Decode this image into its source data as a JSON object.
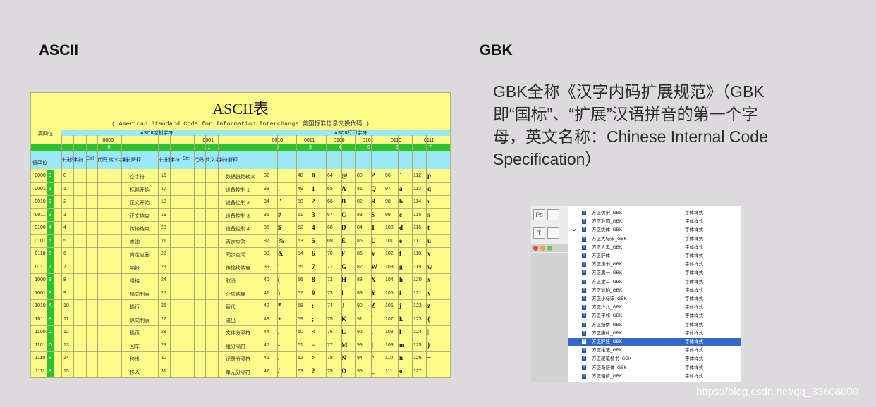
{
  "headings": {
    "ascii": "ASCII",
    "gbk": "GBK"
  },
  "gbk_description": "GBK全称《汉字内码扩展规范》（GBK即“国标”、“扩展”汉语拼音的第一个字母，英文名称：Chinese Internal Code Specification）",
  "ascii_table": {
    "title": "ASCII表",
    "subtitle": "( American Standard Code for Information Interchange  美国标准信息交换代码 )",
    "high_bits_label": "高四位",
    "low_bits_label": "低四位",
    "control_chars_label": "ASCII控制字符",
    "printable_chars_label": "ASCII打印字符",
    "high_groups": [
      "0000",
      "0001",
      "0010",
      "0011",
      "0100",
      "0101",
      "0110",
      "0111"
    ],
    "group_numbers": [
      "0",
      "1",
      "2",
      "3",
      "4",
      "5",
      "6",
      "7"
    ],
    "sub_headers": [
      "十进制",
      "字符",
      "Ctrl",
      "代码",
      "转义字符",
      "字符解释"
    ],
    "rows": [
      {
        "bits": "0000",
        "hex": "0",
        "c0": "0",
        "c0e": "空字符",
        "c1": "16",
        "c1e": "数据链路转义",
        "g2": " ",
        "n2": "32",
        "g3": "0",
        "n3": "48",
        "g4": "@",
        "n4": "64",
        "g5": "P",
        "n5": "80",
        "g6": "`",
        "n6": "96",
        "g7": "p",
        "n7": "112"
      },
      {
        "bits": "0001",
        "hex": "1",
        "c0": "1",
        "c0e": "标题开始",
        "c1": "17",
        "c1e": "设备控制 1",
        "g2": "!",
        "n2": "33",
        "g3": "1",
        "n3": "49",
        "g4": "A",
        "n4": "65",
        "g5": "Q",
        "n5": "81",
        "g6": "a",
        "n6": "97",
        "g7": "q",
        "n7": "113"
      },
      {
        "bits": "0010",
        "hex": "2",
        "c0": "2",
        "c0e": "正文开始",
        "c1": "18",
        "c1e": "设备控制 2",
        "g2": "\"",
        "n2": "34",
        "g3": "2",
        "n3": "50",
        "g4": "B",
        "n4": "66",
        "g5": "R",
        "n5": "82",
        "g6": "b",
        "n6": "98",
        "g7": "r",
        "n7": "114"
      },
      {
        "bits": "0011",
        "hex": "3",
        "c0": "3",
        "c0e": "正文结束",
        "c1": "19",
        "c1e": "设备控制 3",
        "g2": "#",
        "n2": "35",
        "g3": "3",
        "n3": "51",
        "g4": "C",
        "n4": "67",
        "g5": "S",
        "n5": "83",
        "g6": "c",
        "n6": "99",
        "g7": "s",
        "n7": "115"
      },
      {
        "bits": "0100",
        "hex": "4",
        "c0": "4",
        "c0e": "传输结束",
        "c1": "20",
        "c1e": "设备控制 4",
        "g2": "$",
        "n2": "36",
        "g3": "4",
        "n3": "52",
        "g4": "D",
        "n4": "68",
        "g5": "T",
        "n5": "84",
        "g6": "d",
        "n6": "100",
        "g7": "t",
        "n7": "116"
      },
      {
        "bits": "0101",
        "hex": "5",
        "c0": "5",
        "c0e": "查询",
        "c1": "21",
        "c1e": "否定应答",
        "g2": "%",
        "n2": "37",
        "g3": "5",
        "n3": "53",
        "g4": "E",
        "n4": "69",
        "g5": "U",
        "n5": "85",
        "g6": "e",
        "n6": "101",
        "g7": "u",
        "n7": "117"
      },
      {
        "bits": "0110",
        "hex": "6",
        "c0": "6",
        "c0e": "肯定应答",
        "c1": "22",
        "c1e": "同步空闲",
        "g2": "&",
        "n2": "38",
        "g3": "6",
        "n3": "54",
        "g4": "F",
        "n4": "70",
        "g5": "V",
        "n5": "86",
        "g6": "f",
        "n6": "102",
        "g7": "v",
        "n7": "118"
      },
      {
        "bits": "0111",
        "hex": "7",
        "c0": "7",
        "c0e": "响铃",
        "c1": "23",
        "c1e": "传输块结束",
        "g2": "'",
        "n2": "39",
        "g3": "7",
        "n3": "55",
        "g4": "G",
        "n4": "71",
        "g5": "W",
        "n5": "87",
        "g6": "g",
        "n6": "103",
        "g7": "w",
        "n7": "119"
      },
      {
        "bits": "1000",
        "hex": "8",
        "c0": "8",
        "c0e": "退格",
        "c1": "24",
        "c1e": "取消",
        "g2": "(",
        "n2": "40",
        "g3": "8",
        "n3": "56",
        "g4": "H",
        "n4": "72",
        "g5": "X",
        "n5": "88",
        "g6": "h",
        "n6": "104",
        "g7": "x",
        "n7": "120"
      },
      {
        "bits": "1001",
        "hex": "9",
        "c0": "9",
        "c0e": "横向制表",
        "c1": "25",
        "c1e": "介质结束",
        "g2": ")",
        "n2": "41",
        "g3": "9",
        "n3": "57",
        "g4": "I",
        "n4": "73",
        "g5": "Y",
        "n5": "89",
        "g6": "i",
        "n6": "105",
        "g7": "y",
        "n7": "121"
      },
      {
        "bits": "1010",
        "hex": "A",
        "c0": "10",
        "c0e": "换行",
        "c1": "26",
        "c1e": "替代",
        "g2": "*",
        "n2": "42",
        "g3": ":",
        "n3": "58",
        "g4": "J",
        "n4": "74",
        "g5": "Z",
        "n5": "90",
        "g6": "j",
        "n6": "106",
        "g7": "z",
        "n7": "122"
      },
      {
        "bits": "1011",
        "hex": "B",
        "c0": "11",
        "c0e": "纵向制表",
        "c1": "27",
        "c1e": "溢出",
        "g2": "+",
        "n2": "43",
        "g3": ";",
        "n3": "59",
        "g4": "K",
        "n4": "75",
        "g5": "[",
        "n5": "91",
        "g6": "k",
        "n6": "107",
        "g7": "{",
        "n7": "123"
      },
      {
        "bits": "1100",
        "hex": "C",
        "c0": "12",
        "c0e": "换页",
        "c1": "28",
        "c1e": "文件分隔符",
        "g2": ",",
        "n2": "44",
        "g3": "<",
        "n3": "60",
        "g4": "L",
        "n4": "76",
        "g5": "\\",
        "n5": "92",
        "g6": "l",
        "n6": "108",
        "g7": "|",
        "n7": "124"
      },
      {
        "bits": "1101",
        "hex": "D",
        "c0": "13",
        "c0e": "回车",
        "c1": "29",
        "c1e": "组分隔符",
        "g2": "-",
        "n2": "45",
        "g3": "=",
        "n3": "61",
        "g4": "M",
        "n4": "77",
        "g5": "]",
        "n5": "93",
        "g6": "m",
        "n6": "109",
        "g7": "}",
        "n7": "125"
      },
      {
        "bits": "1110",
        "hex": "E",
        "c0": "14",
        "c0e": "移出",
        "c1": "30",
        "c1e": "记录分隔符",
        "g2": ".",
        "n2": "46",
        "g3": ">",
        "n3": "62",
        "g4": "N",
        "n4": "78",
        "g5": "^",
        "n5": "94",
        "g6": "n",
        "n6": "110",
        "g7": "~",
        "n7": "126"
      },
      {
        "bits": "1111",
        "hex": "F",
        "c0": "15",
        "c0e": "移入",
        "c1": "31",
        "c1e": "单元分隔符",
        "g2": "/",
        "n2": "47",
        "g3": "?",
        "n3": "63",
        "g4": "O",
        "n4": "79",
        "g5": "_",
        "n5": "95",
        "g6": "o",
        "n6": "111",
        "g7": "",
        "n7": "127"
      }
    ]
  },
  "font_list": {
    "items": [
      {
        "name": "方正仿宋_GBK",
        "type": "字体样式"
      },
      {
        "name": "方正准圆_GBK",
        "type": "字体样式"
      },
      {
        "name": "方正姚体_GBK",
        "type": "字体样式"
      },
      {
        "name": "方正大标宋_GBK",
        "type": "字体样式"
      },
      {
        "name": "方正大黑_GBK",
        "type": "字体样式"
      },
      {
        "name": "方正舒体",
        "type": "字体样式"
      },
      {
        "name": "方正隶书_GBK",
        "type": "字体样式"
      },
      {
        "name": "方正黑一_GBK",
        "type": "字体样式"
      },
      {
        "name": "方正隶二_GBK",
        "type": "字体样式"
      },
      {
        "name": "方正琥珀_GBK",
        "type": "字体样式"
      },
      {
        "name": "方正小标宋_GBK",
        "type": "字体样式"
      },
      {
        "name": "方正少儿_GBK",
        "type": "字体样式"
      },
      {
        "name": "方正平和_GBK",
        "type": "字体样式"
      },
      {
        "name": "方正细倩_GBK",
        "type": "字体样式"
      },
      {
        "name": "方正康体_GBK",
        "type": "字体样式"
      },
      {
        "name": "方正胖娃_GBK",
        "type": "字体样式"
      },
      {
        "name": "方正稚艺_GBK",
        "type": "字体样式"
      },
      {
        "name": "方正硬笔楷书_GBK",
        "type": "字体样式"
      },
      {
        "name": "方正新舒体_GBK",
        "type": "字体样式"
      },
      {
        "name": "方正粗倩_GBK",
        "type": "字体样式"
      }
    ],
    "selected_index": 15,
    "checked_index": 2
  },
  "watermark": "https://blog.csdn.net/qq_33608000"
}
